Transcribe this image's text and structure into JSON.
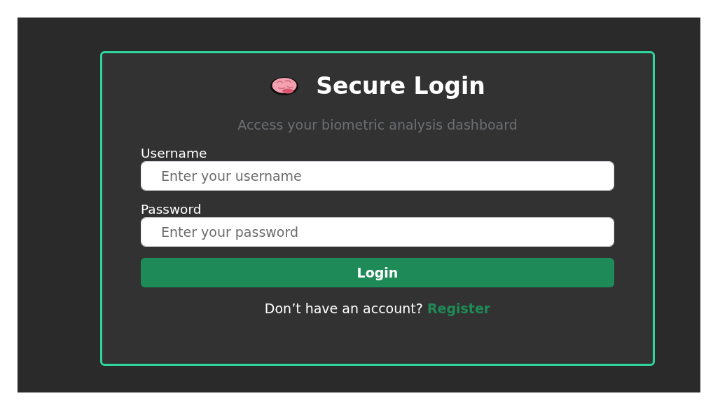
{
  "title": "Secure Login",
  "subtitle": "Access your biometric analysis dashboard",
  "fields": [
    {
      "label": "Username",
      "placeholder": "Enter your username"
    },
    {
      "label": "Password",
      "placeholder": "Enter your password"
    }
  ],
  "submit_button": "Login",
  "footer": {
    "text": "Don’t have an account?",
    "link": "Register"
  }
}
